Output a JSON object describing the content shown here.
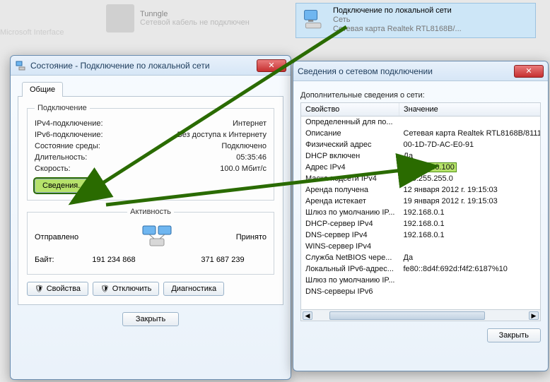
{
  "bg": {
    "item1_title": "Tunngle",
    "item1_sub": "Сетевой кабель не подключен",
    "item2_title": "Microsoft Interface"
  },
  "adapter": {
    "title": "Подключение по локальной сети",
    "sub1": "Сеть",
    "sub2": "Сетевая карта Realtek RTL8168B/..."
  },
  "status": {
    "window_title": "Состояние - Подключение по локальной сети",
    "tab_general": "Общие",
    "group_conn": "Подключение",
    "ipv4_label": "IPv4-подключение:",
    "ipv4_value": "Интернет",
    "ipv6_label": "IPv6-подключение:",
    "ipv6_value": "Без доступа к Интернету",
    "media_label": "Состояние среды:",
    "media_value": "Подключено",
    "dur_label": "Длительность:",
    "dur_value": "05:35:46",
    "speed_label": "Скорость:",
    "speed_value": "100.0 Мбит/с",
    "details_btn": "Сведения...",
    "group_activity": "Активность",
    "sent_label": "Отправлено",
    "recv_label": "Принято",
    "bytes_label": "Байт:",
    "bytes_sent": "191 234 868",
    "bytes_recv": "371 687 239",
    "props_btn": "Свойства",
    "disable_btn": "Отключить",
    "diag_btn": "Диагностика",
    "close_btn": "Закрыть"
  },
  "details": {
    "window_title": "Сведения о сетевом подключении",
    "subheader": "Дополнительные сведения о сети:",
    "col_property": "Свойство",
    "col_value": "Значение",
    "rows": [
      {
        "k": "Определенный для по...",
        "v": ""
      },
      {
        "k": "Описание",
        "v": "Сетевая карта Realtek RTL8168B/8111"
      },
      {
        "k": "Физический адрес",
        "v": "00-1D-7D-AC-E0-91"
      },
      {
        "k": "DHCP включен",
        "v": "Да"
      },
      {
        "k": "Адрес IPv4",
        "v": "192.168.0.100",
        "hl": true
      },
      {
        "k": "Маска подсети IPv4",
        "v": "255.255.255.0"
      },
      {
        "k": "Аренда получена",
        "v": "12 января 2012 г. 19:15:03"
      },
      {
        "k": "Аренда истекает",
        "v": "19 января 2012 г. 19:15:03"
      },
      {
        "k": "Шлюз по умолчанию IP...",
        "v": "192.168.0.1"
      },
      {
        "k": "DHCP-сервер IPv4",
        "v": "192.168.0.1"
      },
      {
        "k": "DNS-сервер IPv4",
        "v": "192.168.0.1"
      },
      {
        "k": "WINS-сервер IPv4",
        "v": ""
      },
      {
        "k": "Служба NetBIOS чере...",
        "v": "Да"
      },
      {
        "k": "Локальный IPv6-адрес...",
        "v": "fe80::8d4f:692d:f4f2:6187%10"
      },
      {
        "k": "Шлюз по умолчанию IP...",
        "v": ""
      },
      {
        "k": "DNS-серверы IPv6",
        "v": ""
      }
    ],
    "close_btn": "Закрыть"
  }
}
